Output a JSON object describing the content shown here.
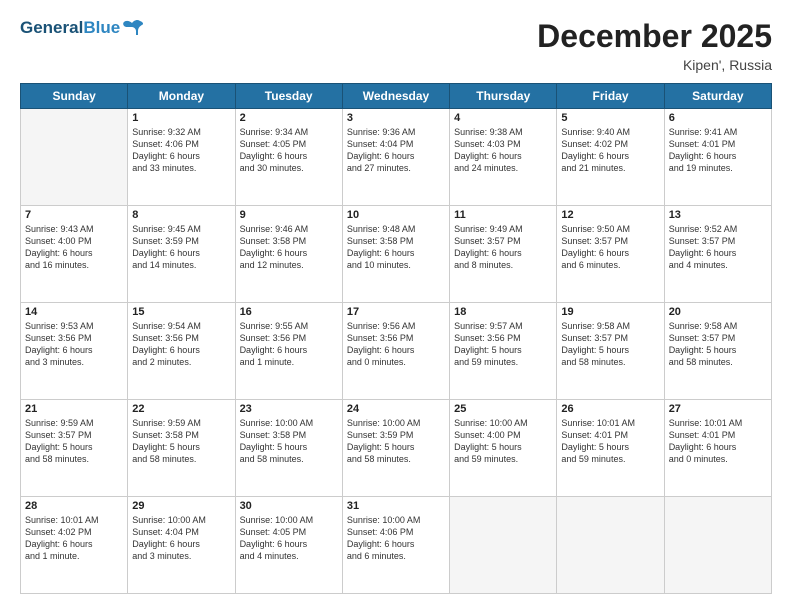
{
  "header": {
    "logo_general": "General",
    "logo_blue": "Blue",
    "month": "December 2025",
    "location": "Kipen', Russia"
  },
  "days_of_week": [
    "Sunday",
    "Monday",
    "Tuesday",
    "Wednesday",
    "Thursday",
    "Friday",
    "Saturday"
  ],
  "weeks": [
    [
      {
        "day": "",
        "content": ""
      },
      {
        "day": "1",
        "content": "Sunrise: 9:32 AM\nSunset: 4:06 PM\nDaylight: 6 hours\nand 33 minutes."
      },
      {
        "day": "2",
        "content": "Sunrise: 9:34 AM\nSunset: 4:05 PM\nDaylight: 6 hours\nand 30 minutes."
      },
      {
        "day": "3",
        "content": "Sunrise: 9:36 AM\nSunset: 4:04 PM\nDaylight: 6 hours\nand 27 minutes."
      },
      {
        "day": "4",
        "content": "Sunrise: 9:38 AM\nSunset: 4:03 PM\nDaylight: 6 hours\nand 24 minutes."
      },
      {
        "day": "5",
        "content": "Sunrise: 9:40 AM\nSunset: 4:02 PM\nDaylight: 6 hours\nand 21 minutes."
      },
      {
        "day": "6",
        "content": "Sunrise: 9:41 AM\nSunset: 4:01 PM\nDaylight: 6 hours\nand 19 minutes."
      }
    ],
    [
      {
        "day": "7",
        "content": "Sunrise: 9:43 AM\nSunset: 4:00 PM\nDaylight: 6 hours\nand 16 minutes."
      },
      {
        "day": "8",
        "content": "Sunrise: 9:45 AM\nSunset: 3:59 PM\nDaylight: 6 hours\nand 14 minutes."
      },
      {
        "day": "9",
        "content": "Sunrise: 9:46 AM\nSunset: 3:58 PM\nDaylight: 6 hours\nand 12 minutes."
      },
      {
        "day": "10",
        "content": "Sunrise: 9:48 AM\nSunset: 3:58 PM\nDaylight: 6 hours\nand 10 minutes."
      },
      {
        "day": "11",
        "content": "Sunrise: 9:49 AM\nSunset: 3:57 PM\nDaylight: 6 hours\nand 8 minutes."
      },
      {
        "day": "12",
        "content": "Sunrise: 9:50 AM\nSunset: 3:57 PM\nDaylight: 6 hours\nand 6 minutes."
      },
      {
        "day": "13",
        "content": "Sunrise: 9:52 AM\nSunset: 3:57 PM\nDaylight: 6 hours\nand 4 minutes."
      }
    ],
    [
      {
        "day": "14",
        "content": "Sunrise: 9:53 AM\nSunset: 3:56 PM\nDaylight: 6 hours\nand 3 minutes."
      },
      {
        "day": "15",
        "content": "Sunrise: 9:54 AM\nSunset: 3:56 PM\nDaylight: 6 hours\nand 2 minutes."
      },
      {
        "day": "16",
        "content": "Sunrise: 9:55 AM\nSunset: 3:56 PM\nDaylight: 6 hours\nand 1 minute."
      },
      {
        "day": "17",
        "content": "Sunrise: 9:56 AM\nSunset: 3:56 PM\nDaylight: 6 hours\nand 0 minutes."
      },
      {
        "day": "18",
        "content": "Sunrise: 9:57 AM\nSunset: 3:56 PM\nDaylight: 5 hours\nand 59 minutes."
      },
      {
        "day": "19",
        "content": "Sunrise: 9:58 AM\nSunset: 3:57 PM\nDaylight: 5 hours\nand 58 minutes."
      },
      {
        "day": "20",
        "content": "Sunrise: 9:58 AM\nSunset: 3:57 PM\nDaylight: 5 hours\nand 58 minutes."
      }
    ],
    [
      {
        "day": "21",
        "content": "Sunrise: 9:59 AM\nSunset: 3:57 PM\nDaylight: 5 hours\nand 58 minutes."
      },
      {
        "day": "22",
        "content": "Sunrise: 9:59 AM\nSunset: 3:58 PM\nDaylight: 5 hours\nand 58 minutes."
      },
      {
        "day": "23",
        "content": "Sunrise: 10:00 AM\nSunset: 3:58 PM\nDaylight: 5 hours\nand 58 minutes."
      },
      {
        "day": "24",
        "content": "Sunrise: 10:00 AM\nSunset: 3:59 PM\nDaylight: 5 hours\nand 58 minutes."
      },
      {
        "day": "25",
        "content": "Sunrise: 10:00 AM\nSunset: 4:00 PM\nDaylight: 5 hours\nand 59 minutes."
      },
      {
        "day": "26",
        "content": "Sunrise: 10:01 AM\nSunset: 4:01 PM\nDaylight: 5 hours\nand 59 minutes."
      },
      {
        "day": "27",
        "content": "Sunrise: 10:01 AM\nSunset: 4:01 PM\nDaylight: 6 hours\nand 0 minutes."
      }
    ],
    [
      {
        "day": "28",
        "content": "Sunrise: 10:01 AM\nSunset: 4:02 PM\nDaylight: 6 hours\nand 1 minute."
      },
      {
        "day": "29",
        "content": "Sunrise: 10:00 AM\nSunset: 4:04 PM\nDaylight: 6 hours\nand 3 minutes."
      },
      {
        "day": "30",
        "content": "Sunrise: 10:00 AM\nSunset: 4:05 PM\nDaylight: 6 hours\nand 4 minutes."
      },
      {
        "day": "31",
        "content": "Sunrise: 10:00 AM\nSunset: 4:06 PM\nDaylight: 6 hours\nand 6 minutes."
      },
      {
        "day": "",
        "content": ""
      },
      {
        "day": "",
        "content": ""
      },
      {
        "day": "",
        "content": ""
      }
    ]
  ]
}
